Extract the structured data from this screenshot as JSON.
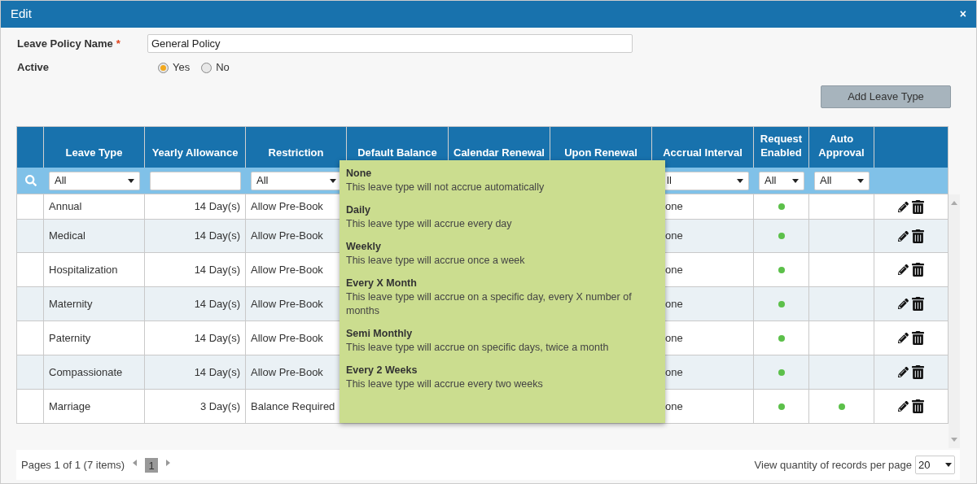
{
  "dialog": {
    "title": "Edit",
    "close": "×"
  },
  "form": {
    "name_label": "Leave Policy Name",
    "required_mark": "*",
    "name_value": "General Policy",
    "active_label": "Active",
    "active_options": [
      {
        "label": "Yes",
        "selected": true
      },
      {
        "label": "No",
        "selected": false
      }
    ]
  },
  "add_button": "Add Leave Type",
  "table": {
    "columns": [
      {
        "label": "Leave Type",
        "filter": {
          "kind": "select",
          "value": "All"
        }
      },
      {
        "label": "Yearly Allowance",
        "filter": {
          "kind": "text"
        }
      },
      {
        "label": "Restriction",
        "filter": {
          "kind": "select",
          "value": "All"
        }
      },
      {
        "label": "Default Balance"
      },
      {
        "label": "Calendar Renewal"
      },
      {
        "label": "Upon Renewal"
      },
      {
        "label": "Accrual Interval",
        "filter": {
          "kind": "select",
          "value": "ll"
        }
      },
      {
        "label": "Request Enabled",
        "filter": {
          "kind": "select",
          "value": "All"
        }
      },
      {
        "label": "Auto Approval",
        "filter": {
          "kind": "select",
          "value": "All"
        }
      }
    ],
    "rows": [
      {
        "leave_type": "Annual",
        "yearly_allowance": "14 Day(s)",
        "restriction": "Allow Pre-Book",
        "accrual_interval": "one",
        "request_enabled": true,
        "auto_approval": false
      },
      {
        "leave_type": "Medical",
        "yearly_allowance": "14 Day(s)",
        "restriction": "Allow Pre-Book",
        "accrual_interval": "one",
        "request_enabled": true,
        "auto_approval": false
      },
      {
        "leave_type": "Hospitalization",
        "yearly_allowance": "14 Day(s)",
        "restriction": "Allow Pre-Book",
        "accrual_interval": "one",
        "request_enabled": true,
        "auto_approval": false
      },
      {
        "leave_type": "Maternity",
        "yearly_allowance": "14 Day(s)",
        "restriction": "Allow Pre-Book",
        "accrual_interval": "one",
        "request_enabled": true,
        "auto_approval": false
      },
      {
        "leave_type": "Paternity",
        "yearly_allowance": "14 Day(s)",
        "restriction": "Allow Pre-Book",
        "accrual_interval": "one",
        "request_enabled": true,
        "auto_approval": false
      },
      {
        "leave_type": "Compassionate",
        "yearly_allowance": "14 Day(s)",
        "restriction": "Allow Pre-Book",
        "accrual_interval": "one",
        "request_enabled": true,
        "auto_approval": false
      },
      {
        "leave_type": "Marriage",
        "yearly_allowance": "3 Day(s)",
        "restriction": "Balance Required",
        "accrual_interval": "one",
        "request_enabled": true,
        "auto_approval": true
      }
    ]
  },
  "accrual_popup": {
    "options": [
      {
        "title": "None",
        "description": "This leave type will not accrue automatically"
      },
      {
        "title": "Daily",
        "description": "This leave type will accrue every day"
      },
      {
        "title": "Weekly",
        "description": "This leave type will accrue once a week"
      },
      {
        "title": "Every X Month",
        "description": "This leave type will accrue on a specific day, every X number of months"
      },
      {
        "title": "Semi Monthly",
        "description": "This leave type will accrue on specific days, twice a month"
      },
      {
        "title": "Every 2 Weeks",
        "description": "This leave type will accrue every two weeks"
      }
    ]
  },
  "footer": {
    "pages_text": "Pages 1 of 1 (7 items)",
    "pages": [
      {
        "label": "1",
        "selected": true
      }
    ],
    "per_page_label": "View quantity of records per page",
    "per_page_value": "20"
  }
}
